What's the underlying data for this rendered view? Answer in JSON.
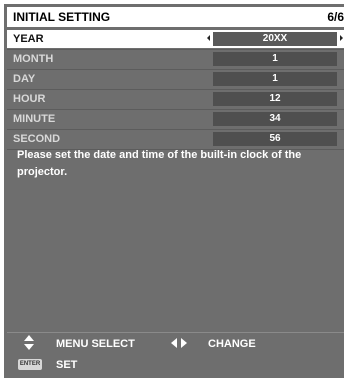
{
  "header": {
    "title": "INITIAL SETTING",
    "page": "6/6"
  },
  "rows": [
    {
      "label": "YEAR",
      "value": "20XX"
    },
    {
      "label": "MONTH",
      "value": "1"
    },
    {
      "label": "DAY",
      "value": "1"
    },
    {
      "label": "HOUR",
      "value": "12"
    },
    {
      "label": "MINUTE",
      "value": "34"
    },
    {
      "label": "SECOND",
      "value": "56"
    }
  ],
  "message": "Please set the date and time of the built-in clock of the projector.",
  "footer": {
    "menu_select": "MENU SELECT",
    "change": "CHANGE",
    "set": "SET",
    "enter_key": "ENTER"
  }
}
